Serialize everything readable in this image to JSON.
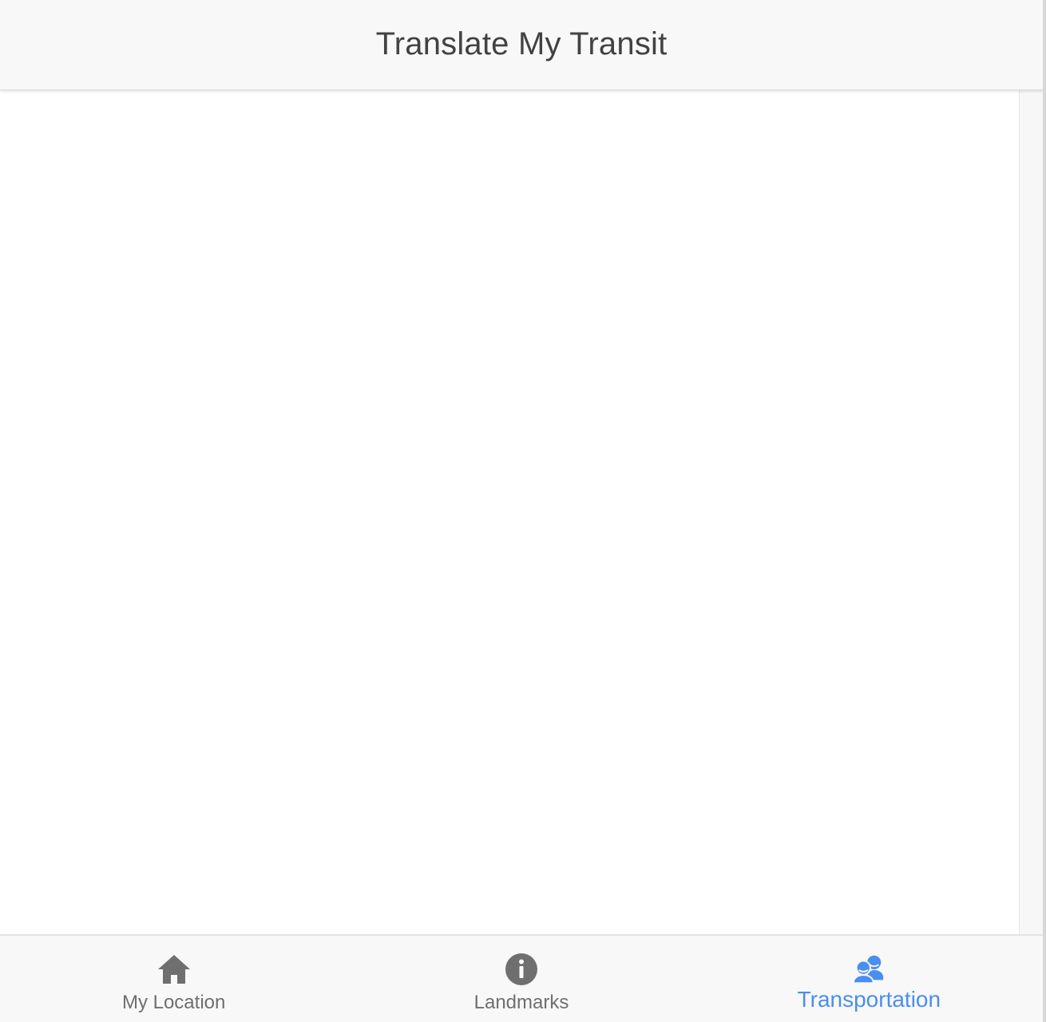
{
  "app": {
    "title": "Translate My Transit"
  },
  "colors": {
    "header_bg": "#f8f8f8",
    "title_text": "#424242",
    "tab_inactive": "#6f6f6f",
    "tab_active": "#4a8ef0"
  },
  "tabs": [
    {
      "label": "My Location",
      "icon": "home-icon",
      "active": false
    },
    {
      "label": "Landmarks",
      "icon": "info-icon",
      "active": false
    },
    {
      "label": "Transportation",
      "icon": "people-icon",
      "active": true
    }
  ]
}
